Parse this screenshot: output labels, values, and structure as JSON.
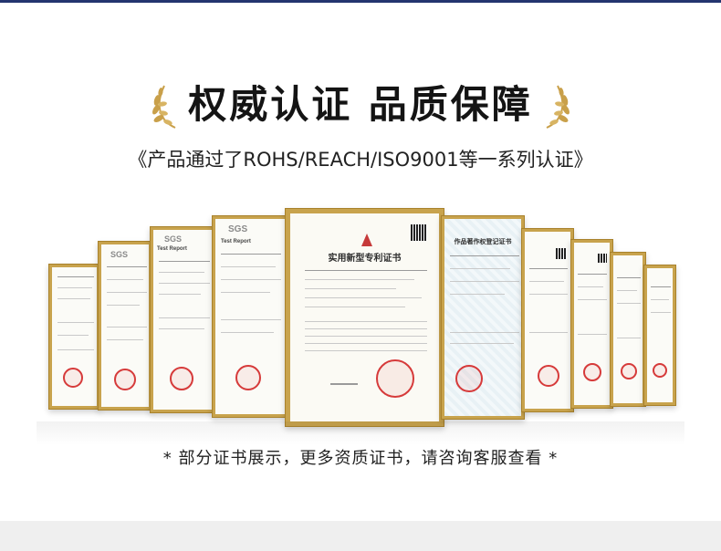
{
  "header": {
    "title": "权威认证 品质保障",
    "subtitle": "《产品通过了ROHS/REACH/ISO9001等一系列认证》"
  },
  "footer": {
    "note": "* 部分证书展示，更多资质证书，请咨询客服查看 *"
  },
  "certificates": {
    "sgs_label": "SGS",
    "test_report_label": "Test Report",
    "patent_title": "实用新型专利证书",
    "copyright_title": "作品著作权登记证书"
  },
  "colors": {
    "frame_gold": "#c8a34d",
    "top_bar": "#24356f",
    "seal_red": "#d63a3a"
  },
  "icons": {
    "laurel_left": "laurel-left-icon",
    "laurel_right": "laurel-right-icon"
  }
}
